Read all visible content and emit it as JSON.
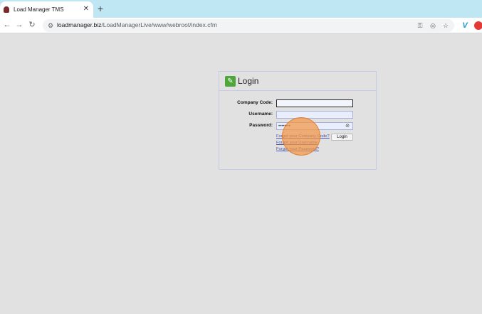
{
  "browser": {
    "tab": {
      "title": "Load Manager TMS",
      "close_glyph": "✕"
    },
    "new_tab_glyph": "+",
    "nav": {
      "back_glyph": "←",
      "forward_glyph": "→",
      "reload_glyph": "↻"
    },
    "omnibox": {
      "url_domain": "loadmanager.biz",
      "url_path": "/LoadManagerLive/www/webroot/index.cfm",
      "site_info_glyph": "⚙"
    },
    "icons": {
      "password_key": "⚿",
      "eye_off": "◎",
      "star": "☆",
      "extension_v": "V",
      "extension_red": "●"
    }
  },
  "login": {
    "title": "Login",
    "logo_glyph": "✎",
    "fields": {
      "company_code": {
        "label": "Company Code:",
        "value": ""
      },
      "username": {
        "label": "Username:",
        "value": ""
      },
      "password": {
        "label": "Password:",
        "value": "••••••••"
      }
    },
    "eye_toggle_glyph": "⊘",
    "button_label": "Login",
    "links": {
      "forgot_company": "Forgot your Company Code?",
      "forgot_username": "Forgot your Username",
      "forgot_password": "Forgot your Password?"
    }
  },
  "colors": {
    "tabstrip": "#bfe6f3",
    "page_background": "#e1e1e1",
    "panel_border": "#c5cbe6",
    "link": "#4c55a8",
    "click_indicator": "#f29646"
  }
}
